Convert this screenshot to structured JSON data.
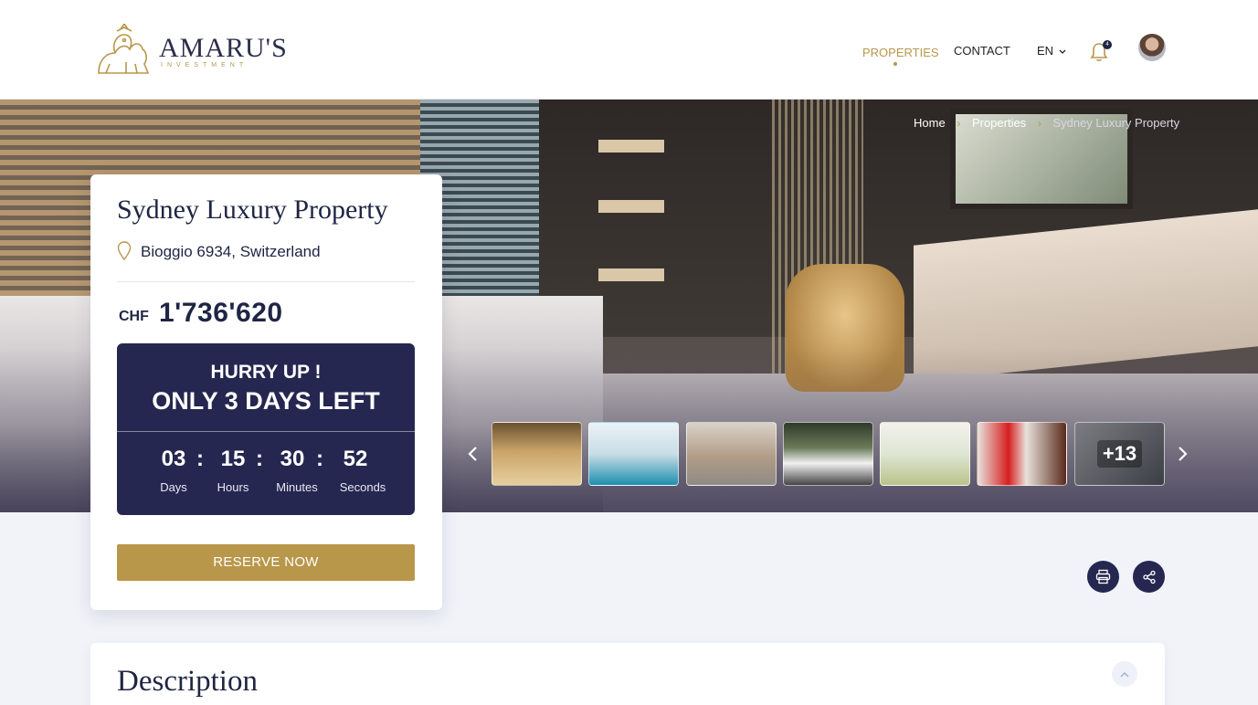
{
  "brand": {
    "name": "AMARU'S",
    "tagline": "INVESTMENT"
  },
  "nav": {
    "items": [
      {
        "label": "PROPERTIES",
        "active": true
      },
      {
        "label": "CONTACT",
        "active": false
      }
    ],
    "language": "EN",
    "notification_count": "4"
  },
  "breadcrumb": {
    "home": "Home",
    "properties": "Properties",
    "current": "Sydney Luxury Property"
  },
  "property": {
    "title": "Sydney Luxury Property",
    "address": "Bioggio 6934, Switzerland",
    "currency": "CHF",
    "price": "1'736'620"
  },
  "countdown": {
    "hurry": "HURRY UP !",
    "days_left": "ONLY 3 DAYS LEFT",
    "days": "03",
    "hours": "15",
    "minutes": "30",
    "seconds": "52",
    "days_label": "Days",
    "hours_label": "Hours",
    "minutes_label": "Minutes",
    "seconds_label": "Seconds",
    "separator": ":"
  },
  "actions": {
    "reserve_label": "RESERVE NOW"
  },
  "gallery": {
    "more_count": "+13"
  },
  "description": {
    "title": "Description"
  },
  "colors": {
    "gold": "#b8974a",
    "navy": "#262750",
    "background": "#f1f3f9"
  },
  "icons": [
    "logo-lion-icon",
    "bell-icon",
    "pin-icon",
    "chevron-left-icon",
    "chevron-right-icon",
    "printer-icon",
    "share-icon",
    "chevron-up-icon"
  ]
}
